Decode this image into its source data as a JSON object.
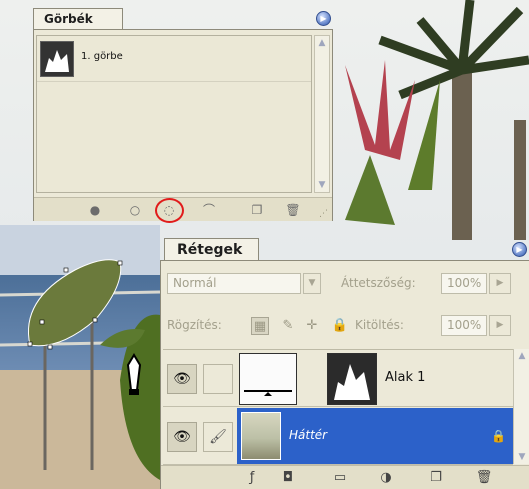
{
  "paths_panel": {
    "tab_title": "Görbék",
    "menu_icon": "triangle-right-icon",
    "rows": [
      {
        "name": "1. görbe"
      }
    ],
    "toolbar_icons": [
      "fill-path-icon",
      "stroke-path-icon",
      "load-path-as-selection-icon",
      "make-work-path-icon",
      "new-path-icon",
      "delete-path-icon"
    ],
    "highlight_color": "#e11b1b"
  },
  "layers_panel": {
    "tab_title": "Rétegek",
    "blend_mode": "Normál",
    "opacity_label": "Áttetszőség:",
    "opacity_value": "100%",
    "lock_label": "Rögzítés:",
    "fill_label": "Kitöltés:",
    "fill_value": "100%",
    "layers": [
      {
        "name": "Alak 1",
        "visible": true
      },
      {
        "name": "Háttér",
        "visible": true,
        "selected": true,
        "locked": true
      }
    ],
    "selection_color": "#2c61c9",
    "toolbar_icons": [
      "layer-style-icon",
      "layer-mask-icon",
      "new-group-icon",
      "adjustment-layer-icon",
      "new-layer-icon",
      "delete-layer-icon"
    ]
  }
}
